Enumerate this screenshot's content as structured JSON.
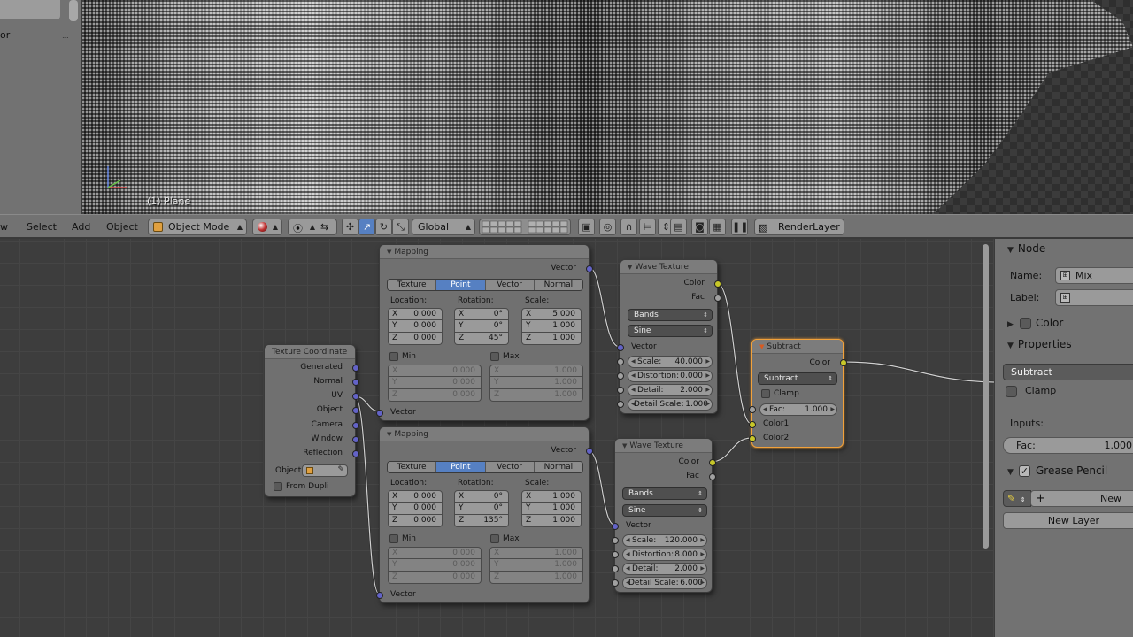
{
  "left_strip": {
    "text": "or"
  },
  "viewport": {
    "object_label": "(1) Plane"
  },
  "header": {
    "menu": [
      "w",
      "Select",
      "Add",
      "Object"
    ],
    "mode": "Object Mode",
    "orientation": "Global",
    "render_layer": "RenderLayer"
  },
  "nodes": {
    "texcoord": {
      "title": "Texture Coordinate",
      "outputs": [
        "Generated",
        "Normal",
        "UV",
        "Object",
        "Camera",
        "Window",
        "Reflection"
      ],
      "object_label": "Object",
      "from_dupli": "From Dupli"
    },
    "mapping": {
      "title": "Mapping",
      "output": "Vector",
      "types": [
        "Texture",
        "Point",
        "Vector",
        "Normal"
      ],
      "active_type": "Point",
      "location_label": "Location:",
      "rotation_label": "Rotation:",
      "scale_label": "Scale:",
      "min_label": "Min",
      "max_label": "Max",
      "input": "Vector"
    },
    "mapping1": {
      "location": [
        "0.000",
        "0.000",
        "0.000"
      ],
      "rotation": [
        "0°",
        "0°",
        "45°"
      ],
      "scale": [
        "5.000",
        "1.000",
        "1.000"
      ],
      "min": [
        "0.000",
        "0.000",
        "0.000"
      ],
      "max": [
        "1.000",
        "1.000",
        "1.000"
      ]
    },
    "mapping2": {
      "location": [
        "0.000",
        "0.000",
        "0.000"
      ],
      "rotation": [
        "0°",
        "0°",
        "135°"
      ],
      "scale": [
        "1.000",
        "1.000",
        "1.000"
      ],
      "min": [
        "0.000",
        "0.000",
        "0.000"
      ],
      "max": [
        "1.000",
        "1.000",
        "1.000"
      ]
    },
    "wave": {
      "title": "Wave Texture",
      "out_color": "Color",
      "out_fac": "Fac",
      "type": "Bands",
      "profile": "Sine",
      "in_vector": "Vector",
      "scale_label": "Scale:",
      "distortion_label": "Distortion:",
      "detail_label": "Detail:",
      "detail_scale_label": "Detail Scale:"
    },
    "wave1": {
      "scale": "40.000",
      "distortion": "0.000",
      "detail": "2.000",
      "detail_scale": "1.000"
    },
    "wave2": {
      "scale": "120.000",
      "distortion": "8.000",
      "detail": "2.000",
      "detail_scale": "6.000"
    },
    "subtract": {
      "title": "Subtract",
      "out_color": "Color",
      "blend": "Subtract",
      "clamp": "Clamp",
      "fac_label": "Fac:",
      "fac": "1.000",
      "color1": "Color1",
      "color2": "Color2"
    }
  },
  "axis_labels": [
    "X",
    "Y",
    "Z"
  ],
  "props": {
    "node_section": "Node",
    "name_label": "Name:",
    "name_value": "Mix",
    "label_label": "Label:",
    "color_section": "Color",
    "properties_section": "Properties",
    "blend_value": "Subtract",
    "clamp": "Clamp",
    "inputs_label": "Inputs:",
    "fac_label": "Fac:",
    "fac_value": "1.000",
    "grease_section": "Grease Pencil",
    "new_button": "New",
    "new_layer_button": "New Layer"
  },
  "colors": {
    "vector_socket": "#6363c7",
    "color_socket": "#c7c729",
    "gray_socket": "#a1a1a1",
    "active_blue": "#5680c2",
    "selected_outline": "#f2a13a"
  }
}
